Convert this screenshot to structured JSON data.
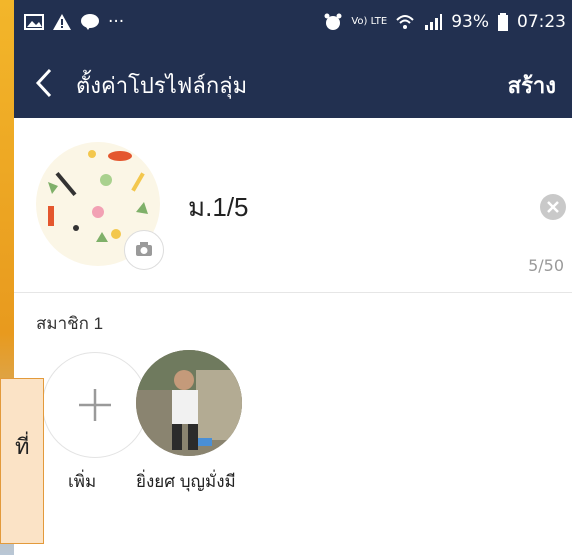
{
  "status_bar": {
    "battery": "93%",
    "time": "07:23",
    "network_label": "Vo) LTE",
    "more": "···"
  },
  "header": {
    "title": "ตั้งค่าโปรไฟล์กลุ่ม",
    "create_label": "สร้าง"
  },
  "profile": {
    "group_name": "ม.1/5",
    "char_count": "5/50"
  },
  "members": {
    "label": "สมาชิก 1",
    "add_label": "เพิ่ม",
    "items": [
      {
        "name": "ยิ่งยศ บุญมั่งมี"
      }
    ]
  },
  "callout": {
    "text": "ที่"
  },
  "colors": {
    "header_bg": "#223050",
    "accent": "#f3a31b"
  }
}
